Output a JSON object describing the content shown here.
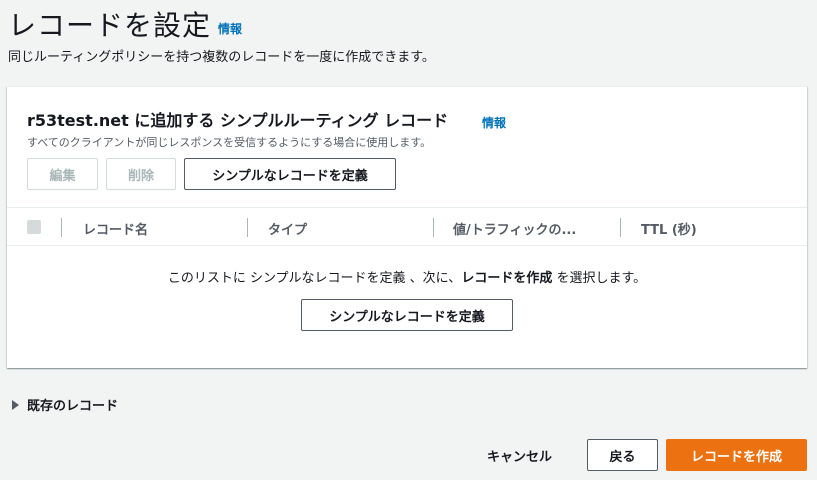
{
  "header": {
    "title": "レコードを設定",
    "info_label": "情報",
    "description": "同じルーティングポリシーを持つ複数のレコードを一度に作成できます。"
  },
  "panel": {
    "title": "r53test.net に追加する シンプルルーティング レコード",
    "info_label": "情報",
    "description": "すべてのクライアントが同じレスポンスを受信するようにする場合に使用します。",
    "buttons": {
      "edit": "編集",
      "delete": "削除",
      "define": "シンプルなレコードを定義"
    },
    "table": {
      "columns": [
        "レコード名",
        "タイプ",
        "値/トラフィックの...",
        "TTL (秒)"
      ],
      "empty": {
        "prefix": "このリストに シンプルなレコードを定義 、次に、",
        "emphasis": "レコードを作成",
        "suffix": " を選択します。",
        "button": "シンプルなレコードを定義"
      }
    }
  },
  "existing_records": {
    "label": "既存のレコード",
    "icon": "caret-right-icon"
  },
  "footer": {
    "cancel": "キャンセル",
    "back": "戻る",
    "create": "レコードを作成"
  },
  "colors": {
    "accent": "#ec7211",
    "link": "#0073bb",
    "background": "#f2f3f3"
  }
}
